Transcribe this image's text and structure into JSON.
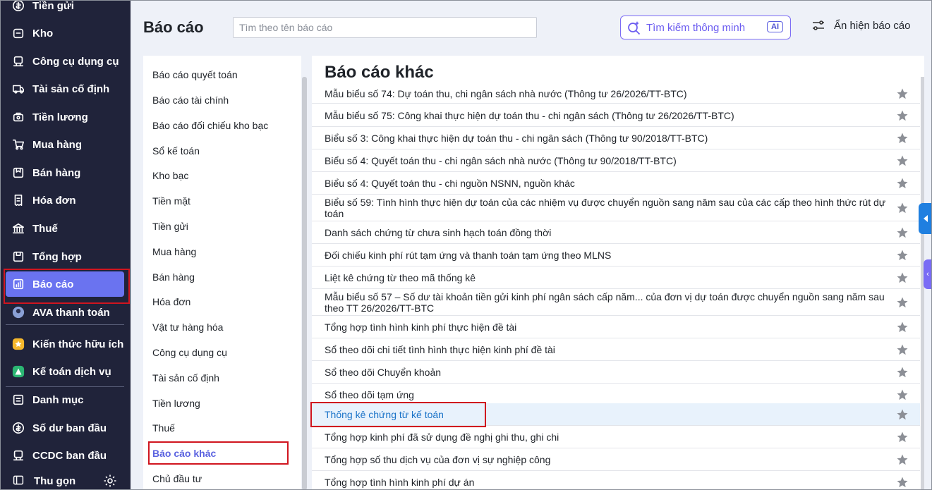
{
  "nav": {
    "items": [
      {
        "label": "Tiền gửi",
        "icon": "coin-icon"
      },
      {
        "label": "Kho",
        "icon": "warehouse-icon"
      },
      {
        "label": "Công cụ dụng cụ",
        "icon": "tools-icon"
      },
      {
        "label": "Tài sản cố định",
        "icon": "truck-icon"
      },
      {
        "label": "Tiền lương",
        "icon": "salary-icon"
      },
      {
        "label": "Mua hàng",
        "icon": "cart-icon"
      },
      {
        "label": "Bán hàng",
        "icon": "sales-icon"
      },
      {
        "label": "Hóa đơn",
        "icon": "invoice-icon"
      },
      {
        "label": "Thuế",
        "icon": "bank-icon"
      },
      {
        "label": "Tổng hợp",
        "icon": "summary-icon"
      },
      {
        "label": "Báo cáo",
        "icon": "report-icon"
      },
      {
        "label": "AVA thanh toán",
        "icon": "ava-icon"
      },
      {
        "label": "Kiến thức hữu ích",
        "icon": "knowledge-icon"
      },
      {
        "label": "Kế toán dịch vụ",
        "icon": "accounting-service-icon"
      },
      {
        "label": "Danh mục",
        "icon": "catalog-icon"
      },
      {
        "label": "Số dư ban đầu",
        "icon": "balance-icon"
      },
      {
        "label": "CCDC ban đầu",
        "icon": "ccdc-icon"
      }
    ],
    "active": "Báo cáo",
    "collapse_label": "Thu gọn"
  },
  "header": {
    "title": "Báo cáo",
    "search_placeholder": "Tìm theo tên báo cáo",
    "smart_search_label": "Tìm kiếm thông minh",
    "ai_badge": "AI",
    "toggle_label": "Ẩn hiện báo cáo"
  },
  "categories": [
    "Báo cáo quyết toán",
    "Báo cáo tài chính",
    "Báo cáo đối chiếu kho bạc",
    "Sổ kế toán",
    "Kho bạc",
    "Tiền mặt",
    "Tiền gửi",
    "Mua hàng",
    "Bán hàng",
    "Hóa đơn",
    "Vật tư hàng hóa",
    "Công cụ dụng cụ",
    "Tài sản cố định",
    "Tiền lương",
    "Thuế",
    "Báo cáo khác",
    "Chủ đầu tư"
  ],
  "active_category": "Báo cáo khác",
  "main": {
    "title": "Báo cáo khác",
    "reports": [
      "Mẫu biểu số 74: Dự toán thu, chi ngân sách nhà nước (Thông tư 26/2026/TT-BTC)",
      "Mẫu biểu số 75: Công khai thực hiện dự toán thu - chi ngân sách (Thông tư 26/2026/TT-BTC)",
      "Biểu số 3: Công khai thực hiện dự toán thu - chi ngân sách (Thông tư 90/2018/TT-BTC)",
      "Biểu số 4: Quyết toán thu - chi ngân sách nhà nước (Thông tư 90/2018/TT-BTC)",
      "Biểu số 4: Quyết toán thu - chi nguồn NSNN, nguồn khác",
      "Biểu số 59: Tình hình thực hiện dự toán của các nhiệm vụ được chuyển nguồn sang năm sau của các cấp theo hình thức rút dự toán",
      "Danh sách chứng từ chưa sinh hạch toán đồng thời",
      "Đối chiếu kinh phí rút tạm ứng và thanh toán tạm ứng theo MLNS",
      "Liệt kê chứng từ theo mã thống kê",
      "Mẫu biểu số 57 – Số dư tài khoản tiền gửi kinh phí ngân sách cấp năm... của đơn vị dự toán được chuyển nguồn sang năm sau theo TT 26/2026/TT-BTC",
      "Tổng hợp tình hình kinh phí thực hiện đề tài",
      "Sổ theo dõi chi tiết tình hình thực hiện kinh phí đề tài",
      "Sổ theo dõi Chuyển khoản",
      "Sổ theo dõi tạm ứng",
      "Thống kê chứng từ kế toán",
      "Tổng hợp kinh phí đã sử dụng đề nghị ghi thu, ghi chi",
      "Tổng hợp số thu dịch vụ của đơn vị sự nghiệp công",
      "Tổng hợp tình hình kinh phí dự án"
    ],
    "highlighted": "Thống kê chứng từ kế toán"
  }
}
